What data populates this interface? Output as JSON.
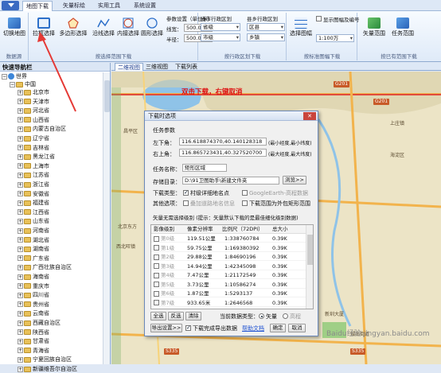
{
  "menubar": {
    "tabs": [
      "地图下载",
      "矢量标绘",
      "实用工具",
      "系统设置"
    ]
  },
  "ribbon": {
    "groups": {
      "datasource": "数据源",
      "select_range": "按选择范围下载",
      "admin": "按行政区划下载",
      "frame": "按标准图幅下载",
      "saved": "按已有范围下载"
    },
    "buttons": {
      "switch_map": "切换地图",
      "rect_select": "拉框选择",
      "poly_select": "多边形选择",
      "line_select": "沿线选择",
      "circle_select": "内接选择",
      "circle2_select": "圆形选择",
      "select_frame": "选择图幅",
      "vector_range": "矢量范围",
      "task_range": "任务范围"
    },
    "params": {
      "title": "参数设置（单位米）",
      "width_label": "线宽：",
      "width_value": "500.00",
      "radius_label": "半径：",
      "radius_value": "500.00"
    },
    "city": {
      "title": "省市行政区划",
      "province": "省级",
      "city": "市级"
    },
    "county": {
      "title": "县乡行政区划",
      "county": "区县",
      "town": "乡镇"
    },
    "frame": {
      "show_label": "显示图幅及编号",
      "scale": "1:100万"
    }
  },
  "sidebar": {
    "title": "快速导航栏",
    "root": "世界",
    "country": "中国",
    "items": [
      "北京市",
      "天津市",
      "河北省",
      "山西省",
      "内蒙古自治区",
      "辽宁省",
      "吉林省",
      "黑龙江省",
      "上海市",
      "江苏省",
      "浙江省",
      "安徽省",
      "福建省",
      "江西省",
      "山东省",
      "河南省",
      "湖北省",
      "湖南省",
      "广东省",
      "广西壮族自治区",
      "海南省",
      "重庆市",
      "四川省",
      "贵州省",
      "云南省",
      "西藏自治区",
      "陕西省",
      "甘肃省",
      "青海省",
      "宁夏回族自治区",
      "新疆维吾尔自治区"
    ]
  },
  "viewtabs": [
    "二维视图",
    "三维视图",
    "下载列表"
  ],
  "map": {
    "instruction": "双击下载，右键取消",
    "roads": [
      "G201",
      "G201",
      "S335",
      "S335"
    ],
    "labels": [
      "北京东方",
      "西北旺镇",
      "新圳大厦",
      "城南街道",
      "上庄镇",
      "海淀区",
      "昌平区"
    ]
  },
  "dialog": {
    "title": "下载时选项",
    "task_section": "任务参数",
    "left_bottom_label": "左下角：",
    "left_bottom_value": "116.618874370,40.140128318",
    "left_bottom_hint": "(最小经度,最小纬度)",
    "right_top_label": "右上角：",
    "right_top_value": "116.865723431,40.327520700",
    "right_top_hint": "(最大经度,最大纬度)",
    "task_name_label": "任务名称：",
    "task_name_value": "矩形区域",
    "save_dir_label": "存储目录：",
    "save_dir_value": "D:\\91卫图助手\\新建文件夹",
    "browse": "浏览>>",
    "download_type_label": "下载类型：",
    "opt_village": "村级详细地名点",
    "opt_google": "GoogleEarth-高程数据",
    "other_label": "其他选项：",
    "opt_overlay": "叠加道路地名信息",
    "opt_limit": "下载范围为外包矩形范围",
    "level_hint": "矢量无需选择级别 (提示：矢量默认下载的是最佳细化级别数据)",
    "columns": [
      "影像级别",
      "像素分辨率",
      "比例尺（72DPI）",
      "总大小"
    ],
    "levels": [
      [
        "第0级",
        "119.51公里",
        "1:338760784",
        "0.39K"
      ],
      [
        "第1级",
        "59.75公里",
        "1:169380392",
        "0.39K"
      ],
      [
        "第2级",
        "29.88公里",
        "1:84690196",
        "0.39K"
      ],
      [
        "第3级",
        "14.94公里",
        "1:42345098",
        "0.39K"
      ],
      [
        "第4级",
        "7.47公里",
        "1:21172549",
        "0.39K"
      ],
      [
        "第5级",
        "3.73公里",
        "1:10586274",
        "0.39K"
      ],
      [
        "第6级",
        "1.87公里",
        "1:5293137",
        "0.39K"
      ],
      [
        "第7级",
        "933.65米",
        "1:2646568",
        "0.39K"
      ]
    ],
    "select_all": "全选",
    "invert": "反选",
    "clear": "清除",
    "current_type_label": "当前数据类型：",
    "type_vector": "矢量",
    "type_elevation": "高程",
    "export_settings": "导出设置>>",
    "export_after": "下载完成导出数据",
    "help": "帮助文档",
    "ok": "确定",
    "cancel": "取消"
  },
  "watermark": "Baidu经验 jingyan.baidu.com"
}
